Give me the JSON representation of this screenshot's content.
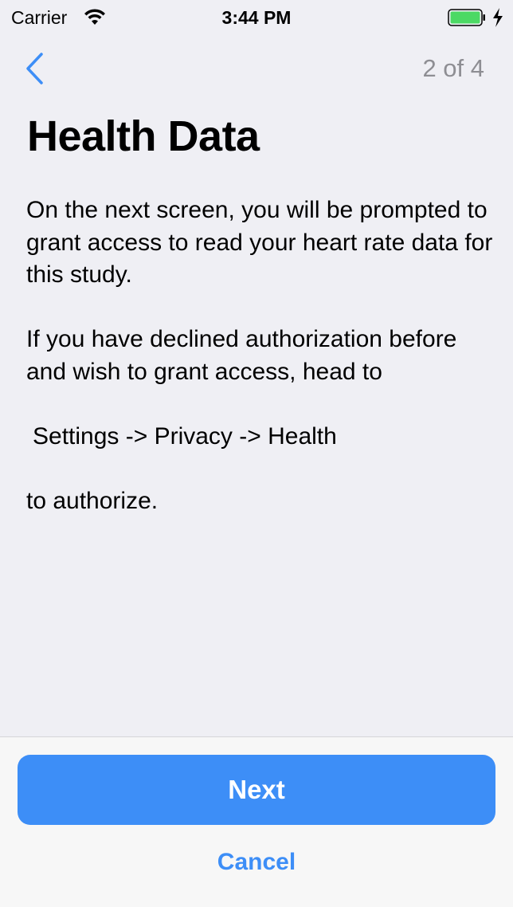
{
  "status_bar": {
    "carrier": "Carrier",
    "time": "3:44 PM",
    "wifi_icon": "wifi-icon",
    "battery_icon": "battery-icon",
    "charging_icon": "charging-bolt-icon",
    "battery_color": "#4cd964"
  },
  "nav": {
    "back_icon": "chevron-left-icon",
    "progress": "2 of 4"
  },
  "content": {
    "title": "Health Data",
    "paragraph_1": "On the next screen, you will be prompted to grant access to read your heart rate data for this study.",
    "paragraph_2": "If you have declined authorization before and wish to grant access, head to",
    "settings_path": "Settings -> Privacy -> Health",
    "paragraph_3": "to authorize."
  },
  "footer": {
    "next_label": "Next",
    "cancel_label": "Cancel"
  },
  "colors": {
    "accent": "#3d8ef7",
    "background": "#efeff4",
    "secondary_text": "#8e8e93"
  }
}
